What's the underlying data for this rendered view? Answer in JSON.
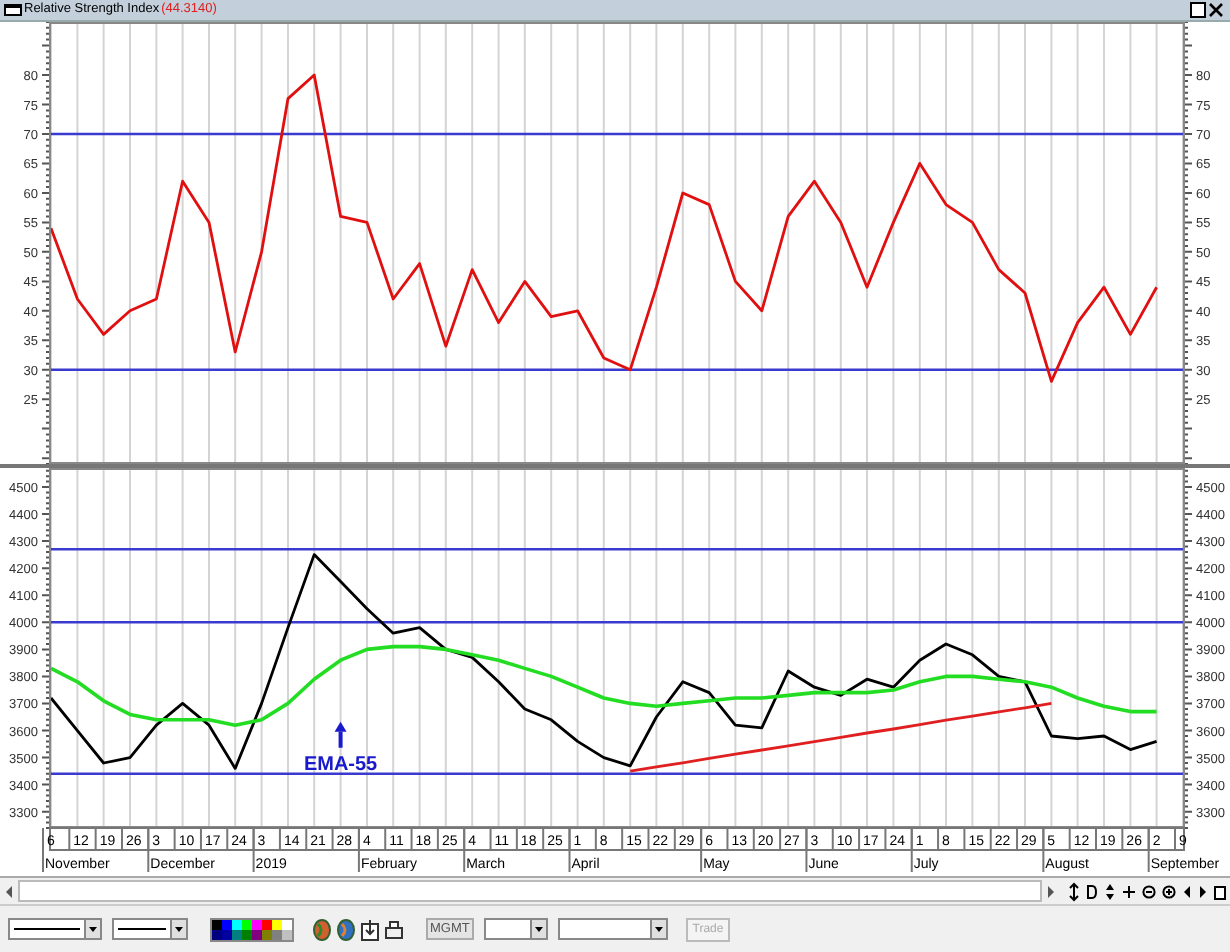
{
  "window": {
    "title": "Relative Strength Index",
    "reading": "(44.3140)"
  },
  "rsi_panel": {
    "chart_data": {
      "type": "line",
      "grid": true,
      "ylim": [
        14,
        89
      ],
      "yticks": [
        25,
        30,
        35,
        40,
        45,
        50,
        55,
        60,
        65,
        70,
        75,
        80
      ],
      "series": [
        {
          "color": "#3a3ad0",
          "values": [
            70,
            70,
            70,
            70,
            70,
            70,
            70,
            70,
            70,
            70,
            70,
            70,
            70,
            70,
            70,
            70,
            70,
            70,
            70,
            70,
            70,
            70,
            70,
            70,
            70,
            70,
            70,
            70,
            70,
            70,
            70,
            70,
            70,
            70,
            70,
            70,
            70,
            70,
            70,
            70,
            70,
            70,
            70,
            70
          ]
        },
        {
          "color": "#3a3ad0",
          "values": [
            30,
            30,
            30,
            30,
            30,
            30,
            30,
            30,
            30,
            30,
            30,
            30,
            30,
            30,
            30,
            30,
            30,
            30,
            30,
            30,
            30,
            30,
            30,
            30,
            30,
            30,
            30,
            30,
            30,
            30,
            30,
            30,
            30,
            30,
            30,
            30,
            30,
            30,
            30,
            30,
            30,
            30,
            30,
            30
          ]
        },
        {
          "color": "#e01010",
          "values": [
            54,
            42,
            36,
            40,
            42,
            62,
            55,
            33,
            50,
            76,
            80,
            56,
            55,
            42,
            48,
            34,
            47,
            38,
            45,
            39,
            40,
            32,
            30,
            44,
            60,
            58,
            45,
            40,
            56,
            62,
            55,
            44,
            55,
            65,
            58,
            55,
            47,
            43,
            28,
            38,
            44,
            36,
            44,
            null
          ]
        }
      ]
    },
    "right_axis": {
      "ticks": [
        "80",
        "75",
        "70",
        "65",
        "60",
        "55",
        "50",
        "45",
        "40",
        "35",
        "30",
        "25"
      ]
    }
  },
  "price_panel": {
    "chart_data": {
      "type": "line",
      "grid": true,
      "ylim": [
        3240,
        4570
      ],
      "yticks": [
        3300,
        3400,
        3500,
        3600,
        3700,
        3800,
        3900,
        4000,
        4100,
        4200,
        4300,
        4400,
        4500
      ],
      "series": [
        {
          "color": "#3a3ad0",
          "values": [
            4270,
            4270,
            4270,
            4270,
            4270,
            4270,
            4270,
            4270,
            4270,
            4270,
            4270,
            4270,
            4270,
            4270,
            4270,
            4270,
            4270,
            4270,
            4270,
            4270,
            4270,
            4270,
            4270,
            4270,
            4270,
            4270,
            4270,
            4270,
            4270,
            4270,
            4270,
            4270,
            4270,
            4270,
            4270,
            4270,
            4270,
            4270,
            4270,
            4270,
            4270,
            4270,
            4270,
            4270
          ]
        },
        {
          "color": "#3a3ad0",
          "values": [
            4000,
            4000,
            4000,
            4000,
            4000,
            4000,
            4000,
            4000,
            4000,
            4000,
            4000,
            4000,
            4000,
            4000,
            4000,
            4000,
            4000,
            4000,
            4000,
            4000,
            4000,
            4000,
            4000,
            4000,
            4000,
            4000,
            4000,
            4000,
            4000,
            4000,
            4000,
            4000,
            4000,
            4000,
            4000,
            4000,
            4000,
            4000,
            4000,
            4000,
            4000,
            4000,
            4000,
            4000
          ]
        },
        {
          "color": "#3a3ad0",
          "values": [
            3440,
            3440,
            3440,
            3440,
            3440,
            3440,
            3440,
            3440,
            3440,
            3440,
            3440,
            3440,
            3440,
            3440,
            3440,
            3440,
            3440,
            3440,
            3440,
            3440,
            3440,
            3440,
            3440,
            3440,
            3440,
            3440,
            3440,
            3440,
            3440,
            3440,
            3440,
            3440,
            3440,
            3440,
            3440,
            3440,
            3440,
            3440,
            3440,
            3440,
            3440,
            3440,
            3440,
            3440
          ]
        },
        {
          "color": "#000000",
          "values": [
            3720,
            3600,
            3480,
            3500,
            3620,
            3700,
            3620,
            3460,
            3700,
            3980,
            4250,
            4150,
            4050,
            3960,
            3980,
            3900,
            3870,
            3780,
            3680,
            3640,
            3560,
            3500,
            3470,
            3650,
            3780,
            3740,
            3620,
            3610,
            3820,
            3760,
            3730,
            3790,
            3760,
            3860,
            3920,
            3880,
            3800,
            3780,
            3580,
            3570,
            3580,
            3530,
            3560,
            null
          ]
        },
        {
          "name": "EMA-55",
          "color": "#22dd22",
          "values": [
            3830,
            3780,
            3710,
            3660,
            3640,
            3640,
            3640,
            3620,
            3640,
            3700,
            3790,
            3860,
            3900,
            3910,
            3910,
            3900,
            3880,
            3860,
            3830,
            3800,
            3760,
            3720,
            3700,
            3690,
            3700,
            3710,
            3720,
            3720,
            3730,
            3740,
            3740,
            3740,
            3750,
            3780,
            3800,
            3800,
            3790,
            3780,
            3760,
            3720,
            3690,
            3670,
            3670,
            null
          ]
        },
        {
          "color": "#e02020",
          "values": [
            null,
            null,
            null,
            null,
            null,
            null,
            null,
            null,
            null,
            null,
            null,
            null,
            null,
            null,
            null,
            null,
            null,
            null,
            null,
            null,
            null,
            null,
            3450,
            3466,
            3481,
            3497,
            3513,
            3528,
            3544,
            3559,
            3575,
            3591,
            3606,
            3622,
            3638,
            3653,
            3669,
            3684,
            3700,
            null,
            null,
            null,
            null,
            null
          ]
        }
      ]
    },
    "right_axis": {
      "ticks": [
        "4500",
        "4400",
        "4300",
        "4200",
        "4100",
        "4000",
        "3900",
        "3800",
        "3700",
        "3600",
        "3500",
        "3400",
        "3300"
      ]
    }
  },
  "date_axis": {
    "months": [
      {
        "label": "November",
        "days": [
          "6",
          "12",
          "19",
          "26"
        ]
      },
      {
        "label": "December",
        "days": [
          "3",
          "10",
          "17",
          "24"
        ]
      },
      {
        "label": "2019",
        "days": [
          "3",
          "14",
          "21",
          "28"
        ]
      },
      {
        "label": "February",
        "days": [
          "4",
          "11",
          "18",
          "25"
        ]
      },
      {
        "label": "March",
        "days": [
          "4",
          "11",
          "18",
          "25"
        ]
      },
      {
        "label": "April",
        "days": [
          "1",
          "8",
          "15",
          "22",
          "29"
        ]
      },
      {
        "label": "May",
        "days": [
          "6",
          "13",
          "20",
          "27"
        ]
      },
      {
        "label": "June",
        "days": [
          "3",
          "10",
          "17",
          "24"
        ]
      },
      {
        "label": "July",
        "days": [
          "1",
          "8",
          "15",
          "22",
          "29"
        ]
      },
      {
        "label": "August",
        "days": [
          "5",
          "12",
          "19",
          "26"
        ]
      },
      {
        "label": "September",
        "days": [
          "2",
          "9"
        ]
      }
    ]
  },
  "toolbar": {
    "palette": [
      {
        "color": "#000000"
      },
      {
        "color": "#0000ff"
      },
      {
        "color": "#00ffff"
      },
      {
        "color": "#00ff00"
      },
      {
        "color": "#ff00ff"
      },
      {
        "color": "#ff0000"
      },
      {
        "color": "#ffff00"
      },
      {
        "color": "#ffffff"
      },
      {
        "color": "#000080"
      },
      {
        "color": "#0000a0"
      },
      {
        "color": "#008080"
      },
      {
        "color": "#008000"
      },
      {
        "color": "#800080"
      },
      {
        "color": "#808000"
      },
      {
        "color": "#808080"
      },
      {
        "color": "#c0c0c0"
      }
    ],
    "symbol_field": {
      "value": "MGMT",
      "disabled": true
    },
    "trade_button": {
      "label": "Trade",
      "disabled": true
    }
  }
}
